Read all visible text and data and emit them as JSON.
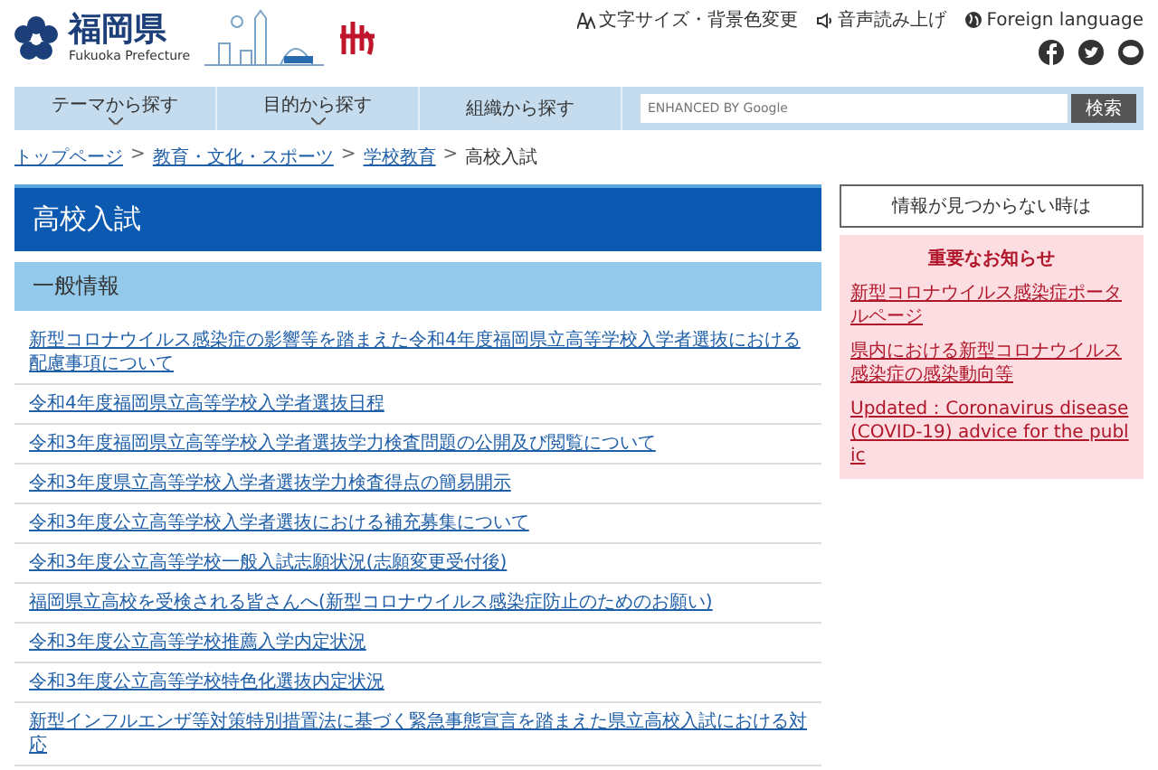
{
  "header": {
    "logo_title": "福岡県",
    "logo_subtitle": "Fukuoka Prefecture",
    "utility_links": [
      "文字サイズ・背景色変更",
      "音声読み上げ",
      "Foreign language"
    ]
  },
  "nav": {
    "items": [
      {
        "label": "テーマから探す",
        "expandable": true
      },
      {
        "label": "目的から探す",
        "expandable": true
      },
      {
        "label": "組織から探す",
        "expandable": false
      }
    ],
    "search": {
      "placeholder": "ENHANCED BY Google",
      "button": "検索"
    }
  },
  "breadcrumbs": [
    {
      "label": "トップページ",
      "kind": "link"
    },
    {
      "label": ">",
      "kind": "separator"
    },
    {
      "label": "教育・文化・スポーツ",
      "kind": "link"
    },
    {
      "label": ">",
      "kind": "separator"
    },
    {
      "label": "学校教育",
      "kind": "link"
    },
    {
      "label": ">",
      "kind": "separator"
    },
    {
      "label": "高校入試",
      "kind": "current"
    }
  ],
  "page_title": "高校入試",
  "section": {
    "heading": "一般情報",
    "links": [
      "新型コロナウイルス感染症の影響等を踏まえた令和4年度福岡県立高等学校入学者選抜における配慮事項について",
      "令和4年度福岡県立高等学校入学者選抜日程",
      "令和3年度福岡県立高等学校入学者選抜学力検査問題の公開及び閲覧について",
      "令和3年度県立高等学校入学者選抜学力検査得点の簡易開示",
      "令和3年度公立高等学校入学者選抜における補充募集について",
      "令和3年度公立高等学校一般入試志願状況(志願変更受付後)",
      "福岡県立高校を受検される皆さんへ(新型コロナウイルス感染症防止のためのお願い)",
      "令和3年度公立高等学校推薦入学内定状況",
      "令和3年度公立高等学校特色化選抜内定状況",
      "新型インフルエンザ等対策特別措置法に基づく緊急事態宣言を踏まえた県立高校入試における対応"
    ]
  },
  "sidebar": {
    "help_button": "情報が見つからない時は",
    "notice": {
      "heading": "重要なお知らせ",
      "links": [
        "新型コロナウイルス感染症ポータルページ",
        "県内における新型コロナウイルス感染症の感染動向等",
        "Updated：Coronavirus disease(COVID-19) advice for the public"
      ]
    }
  }
}
